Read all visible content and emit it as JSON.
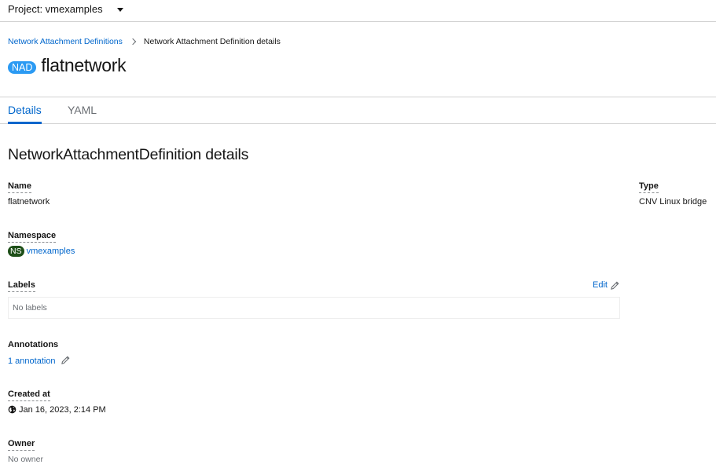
{
  "topbar": {
    "project_label": "Project: vmexamples"
  },
  "breadcrumb": {
    "parent": "Network Attachment Definitions",
    "current": "Network Attachment Definition details"
  },
  "header": {
    "badge": "NAD",
    "title": "flatnetwork"
  },
  "tabs": [
    {
      "label": "Details",
      "active": true
    },
    {
      "label": "YAML",
      "active": false
    }
  ],
  "details": {
    "section_title": "NetworkAttachmentDefinition details",
    "name": {
      "label": "Name",
      "value": "flatnetwork"
    },
    "namespace": {
      "label": "Namespace",
      "badge": "NS",
      "value": "vmexamples"
    },
    "labels": {
      "label": "Labels",
      "edit": "Edit",
      "empty": "No labels"
    },
    "annotations": {
      "label": "Annotations",
      "value": "1 annotation"
    },
    "created_at": {
      "label": "Created at",
      "value": "Jan 16, 2023, 2:14 PM"
    },
    "owner": {
      "label": "Owner",
      "value": "No owner"
    },
    "type": {
      "label": "Type",
      "value": "CNV Linux bridge"
    }
  },
  "colors": {
    "link": "#0066cc",
    "nad_badge": "#2b9af3",
    "ns_badge": "#1e4f18"
  }
}
